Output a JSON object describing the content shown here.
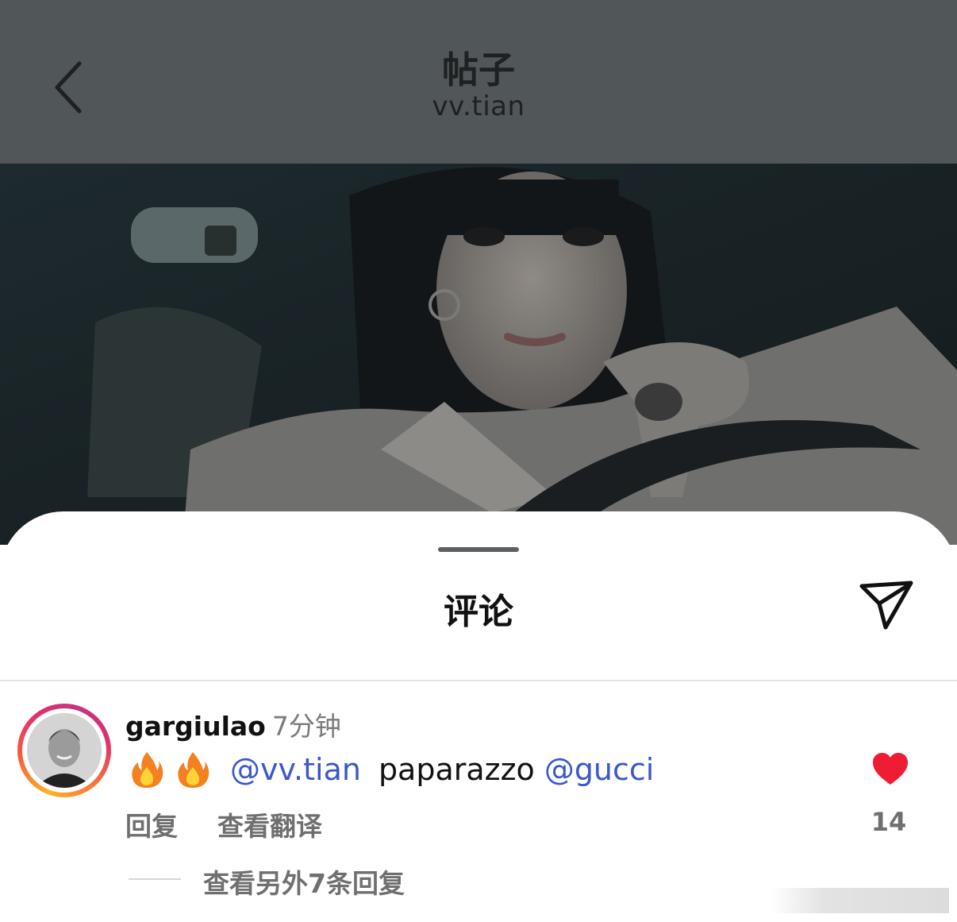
{
  "header": {
    "title": "帖子",
    "subtitle": "vv.tian"
  },
  "sheet": {
    "title": "评论"
  },
  "comment": {
    "username": "gargiulao",
    "time": "7分钟",
    "emojis": [
      "fire",
      "fire"
    ],
    "mention_1": "@vv.tian",
    "text": "paparazzo",
    "mention_2": "@gucci",
    "reply_label": "回复",
    "translate_label": "查看翻译",
    "like_count": "14",
    "view_replies_label": "查看另外7条回复"
  },
  "colors": {
    "mention": "#3a58c9",
    "like_heart": "#ee1d34",
    "overlay": "#515659"
  },
  "icons": [
    "back-chevron-icon",
    "share-send-icon",
    "heart-icon",
    "fire-emoji-icon"
  ]
}
